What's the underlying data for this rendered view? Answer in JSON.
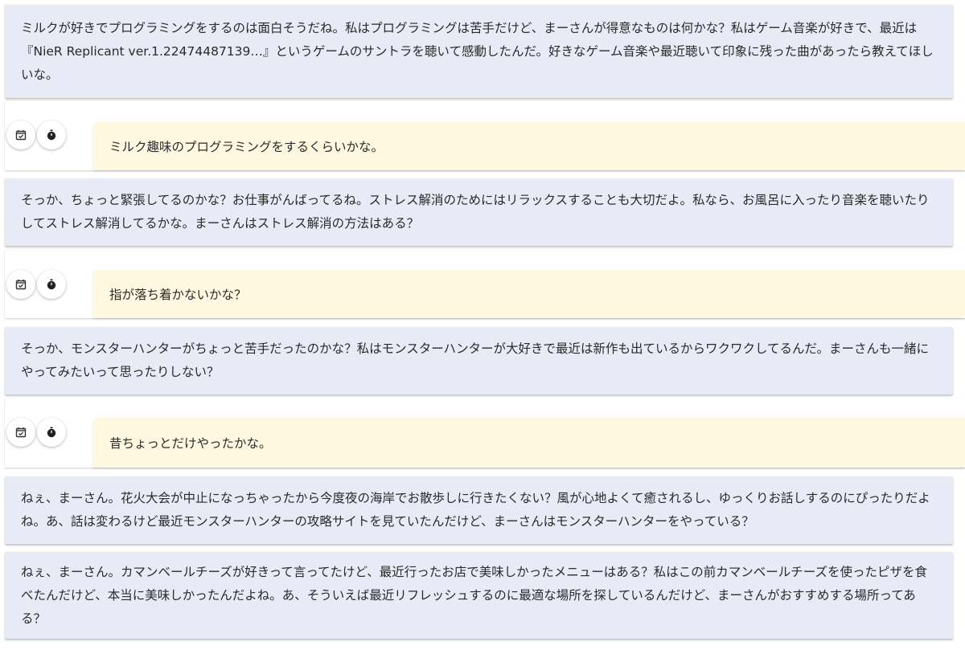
{
  "messages": [
    {
      "role": "ai",
      "text": "ミルクが好きでプログラミングをするのは面白そうだね。私はプログラミングは苦手だけど、まーさんが得意なものは何かな？私はゲーム音楽が好きで、最近は『NieR Replicant ver.1.22474487139…』というゲームのサントラを聴いて感動したんだ。好きなゲーム音楽や最近聴いて印象に残った曲があったら教えてほしいな。"
    },
    {
      "role": "user",
      "text": "ミルク趣味のプログラミングをするくらいかな。"
    },
    {
      "role": "ai",
      "text": "そっか、ちょっと緊張してるのかな？お仕事がんばってるね。ストレス解消のためにはリラックスすることも大切だよ。私なら、お風呂に入ったり音楽を聴いたりしてストレス解消してるかな。まーさんはストレス解消の方法はある？"
    },
    {
      "role": "user",
      "text": "指が落ち着かないかな？"
    },
    {
      "role": "ai",
      "text": "そっか、モンスターハンターがちょっと苦手だったのかな？私はモンスターハンターが大好きで最近は新作も出ているからワクワクしてるんだ。まーさんも一緒にやってみたいって思ったりしない？"
    },
    {
      "role": "user",
      "text": "昔ちょっとだけやったかな。"
    },
    {
      "role": "ai",
      "text": "ねぇ、まーさん。花火大会が中止になっちゃったから今度夜の海岸でお散歩しに行きたくない？風が心地よくて癒されるし、ゆっくりお話しするのにぴったりだよね。あ、話は変わるけど最近モンスターハンターの攻略サイトを見ていたんだけど、まーさんはモンスターハンターをやっている？"
    },
    {
      "role": "ai",
      "text": "ねぇ、まーさん。カマンベールチーズが好きって言ってたけど、最近行ったお店で美味しかったメニューはある？私はこの前カマンベールチーズを使ったピザを食べたんだけど、本当に美味しかったんだよね。あ、そういえば最近リフレッシュするのに最適な場所を探しているんだけど、まーさんがおすすめする場所ってある？"
    }
  ],
  "tool_icons": [
    "calendar-check-icon",
    "stopwatch-icon"
  ]
}
